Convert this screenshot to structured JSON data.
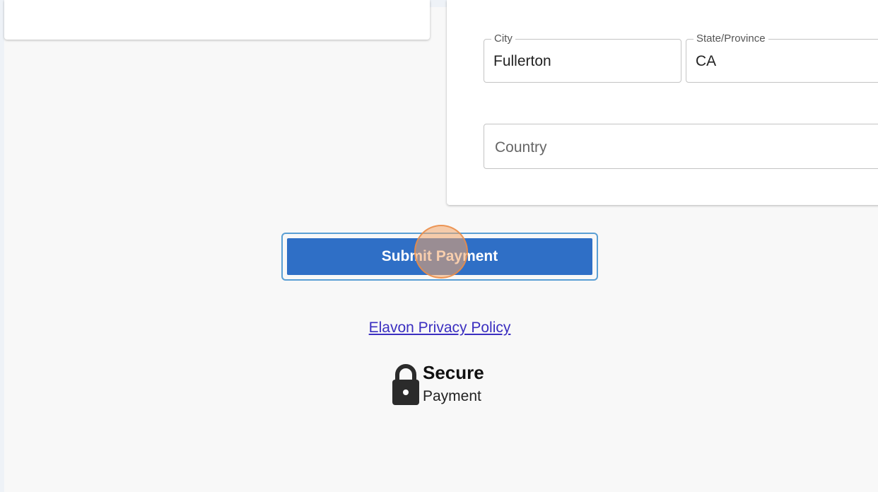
{
  "address": {
    "city": {
      "label": "City",
      "value": "Fullerton"
    },
    "state": {
      "label": "State/Province",
      "value": "CA"
    },
    "country": {
      "placeholder": "Country"
    }
  },
  "actions": {
    "submit_label": "Submit Payment"
  },
  "footer": {
    "privacy_link": "Elavon Privacy Policy",
    "secure_title": "Secure",
    "secure_subtitle": "Payment"
  },
  "icons": {
    "lock": "lock-icon"
  },
  "colors": {
    "submit_button": "#2f6fc6",
    "submit_focus_ring": "#5a9fd4",
    "link": "#3b2fc0",
    "click_indicator": "#f2a569"
  }
}
